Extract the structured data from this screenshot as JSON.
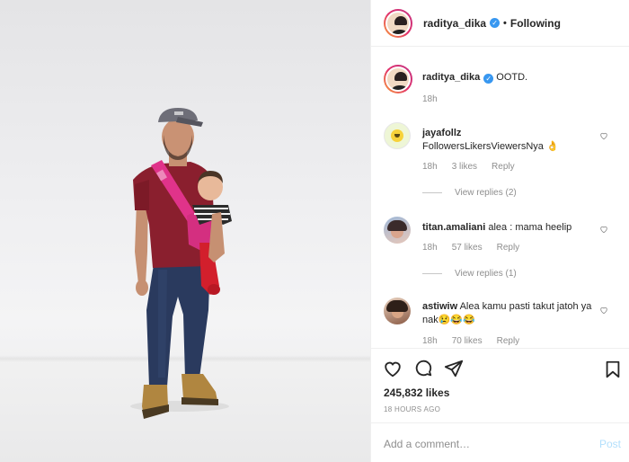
{
  "header": {
    "username": "raditya_dika",
    "separator": "•",
    "follow_status": "Following"
  },
  "caption": {
    "username": "raditya_dika",
    "text": "OOTD.",
    "age": "18h"
  },
  "comments": [
    {
      "username": "jayafollz",
      "text": "FollowersLikersViewersNya 👌",
      "age": "18h",
      "likes": "3 likes",
      "reply": "Reply",
      "view_replies": "View replies (2)"
    },
    {
      "username": "titan.amaliani",
      "text": "alea : mama heelip",
      "age": "18h",
      "likes": "57 likes",
      "reply": "Reply",
      "view_replies": "View replies (1)"
    },
    {
      "username": "astiwiw",
      "text": "Alea kamu pasti takut jatoh ya nak😢😂😂",
      "age": "18h",
      "likes": "70 likes",
      "reply": "Reply"
    }
  ],
  "post": {
    "likes": "245,832 likes",
    "time": "18 HOURS AGO"
  },
  "comment_box": {
    "placeholder": "Add a comment…",
    "post_label": "Post"
  },
  "icons": {
    "like": "heart-icon",
    "comment": "comment-icon",
    "share": "paper-plane-icon",
    "save": "bookmark-icon",
    "verified": "verified-badge-icon"
  },
  "colors": {
    "verified": "#3897f0",
    "muted": "#8e8e8e",
    "post_disabled": "#b2dffc"
  }
}
